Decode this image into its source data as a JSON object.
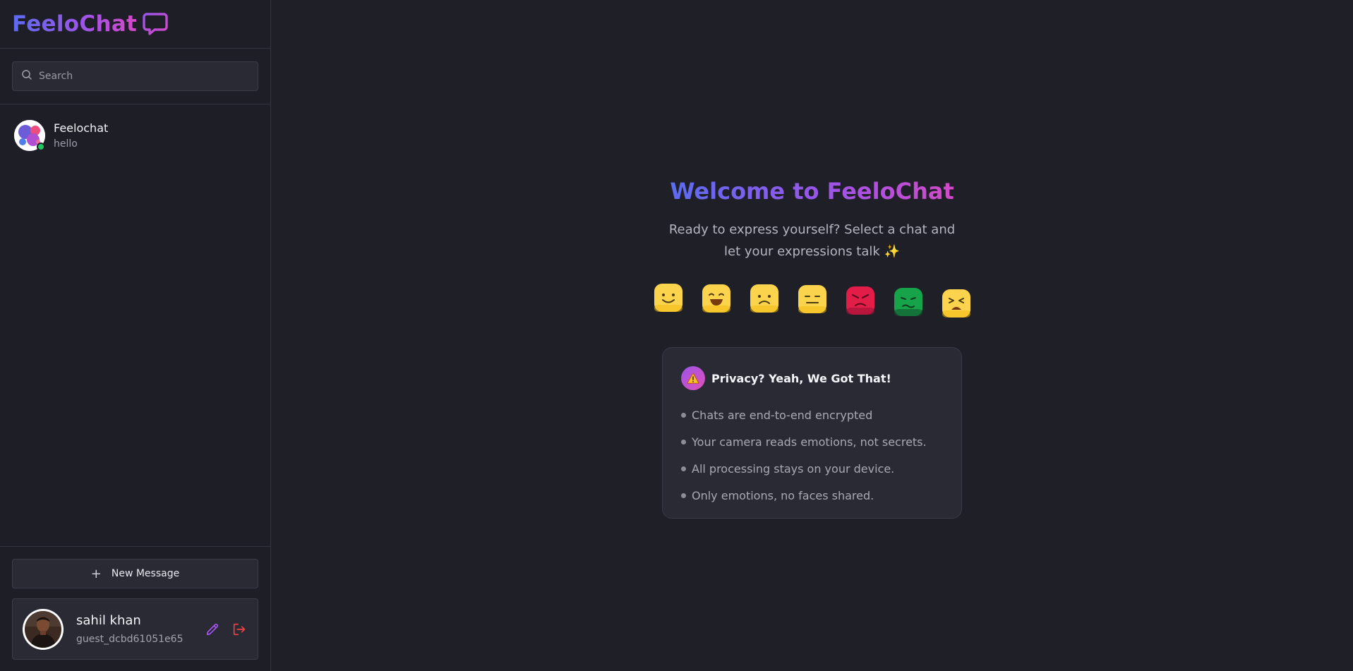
{
  "app": {
    "brand_name": "FeeloChat",
    "brand_icon": "chat-bubble-icon",
    "accent_gradient": [
      "#5b6cf0",
      "#9b55e8",
      "#d349c8"
    ]
  },
  "sidebar": {
    "search": {
      "placeholder": "Search",
      "value": ""
    },
    "chats": [
      {
        "name": "Feelochat",
        "preview": "hello",
        "online": true,
        "status_color": "#22c55e"
      }
    ],
    "new_message_label": "New Message",
    "profile": {
      "name": "sahil khan",
      "id": "guest_dcbd61051e65",
      "edit_icon": "pencil-icon",
      "logout_icon": "logout-icon",
      "edit_color": "#a855f7",
      "logout_color": "#ef4444"
    }
  },
  "main": {
    "welcome_title": "Welcome to FeeloChat",
    "welcome_subtitle": "Ready to express yourself? Select a chat and let your expressions talk ✨",
    "emotion_faces": [
      {
        "name": "happy",
        "color": "#fcd34d"
      },
      {
        "name": "joy",
        "color": "#fcd34d"
      },
      {
        "name": "sad",
        "color": "#fcd34d"
      },
      {
        "name": "neutral",
        "color": "#fcd34d"
      },
      {
        "name": "angry",
        "color": "#e11d48"
      },
      {
        "name": "disgust",
        "color": "#16a34a"
      },
      {
        "name": "fear",
        "color": "#fcd34d"
      }
    ],
    "privacy": {
      "title": "Privacy? Yeah, We Got That!",
      "icon": "warning-icon",
      "items": [
        "Chats are end-to-end encrypted",
        "Your camera reads emotions, not secrets.",
        "All processing stays on your device.",
        "Only emotions, no faces shared."
      ]
    }
  }
}
